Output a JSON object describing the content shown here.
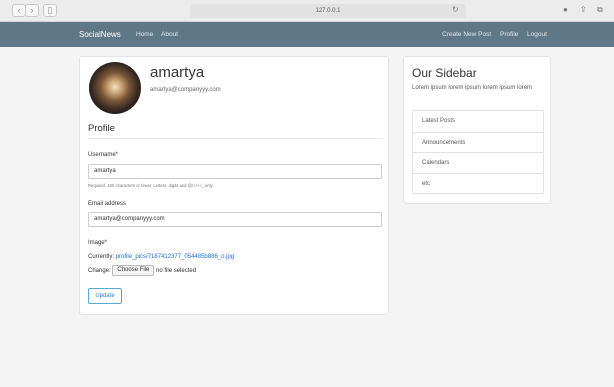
{
  "browser": {
    "url": "127.0.0.1",
    "back_icon": "chevron-left-icon",
    "forward_icon": "chevron-right-icon",
    "sidebar_icon": "sidebar-icon",
    "reload_icon": "reload-icon"
  },
  "navbar": {
    "brand": "SocialNews",
    "left_links": [
      "Home",
      "About"
    ],
    "right_links": [
      "Create New Post",
      "Profile",
      "Logout"
    ],
    "background": "#5f7887"
  },
  "profile": {
    "username": "amartya",
    "email": "amartya@companyyy.com",
    "section_title": "Profile",
    "form": {
      "username_label": "Username*",
      "username_value": "amartya",
      "username_help": "Required. 150 characters or fewer. Letters, digits and @/./+/-/_ only.",
      "email_label": "Email address",
      "email_value": "amartya@companyyy.com",
      "image_label": "Image*",
      "currently_label": "Currently:",
      "currently_link": "profile_pics/7187412377_054485b886_o.jpg",
      "change_label": "Change:",
      "choose_file": "Choose File",
      "no_file": "no file selected",
      "update_button": "Update"
    }
  },
  "sidebar": {
    "title": "Our Sidebar",
    "description": "Lorem ipsum lorem ipsum lorem ipsum lorem",
    "items": [
      "Latest Posts",
      "Announcements",
      "Calendars",
      "etc"
    ]
  }
}
